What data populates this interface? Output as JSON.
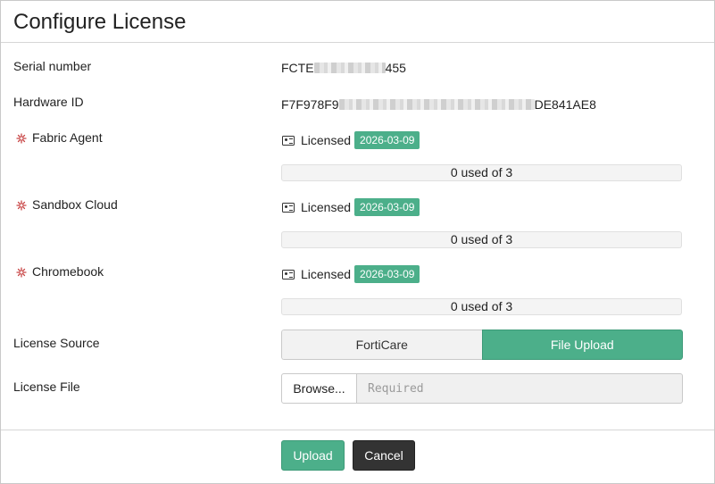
{
  "dialog": {
    "title": "Configure License"
  },
  "serial": {
    "label": "Serial number",
    "prefix": "FCTE",
    "suffix": "455"
  },
  "hardware": {
    "label": "Hardware ID",
    "prefix": "F7F978F9",
    "suffix": "DE841AE8"
  },
  "licenses": [
    {
      "label": "Fabric Agent",
      "status": "Licensed",
      "expiry": "2026-03-09",
      "usage": "0 used of 3",
      "used_fraction": 0
    },
    {
      "label": "Sandbox Cloud",
      "status": "Licensed",
      "expiry": "2026-03-09",
      "usage": "0 used of 3",
      "used_fraction": 0
    },
    {
      "label": "Chromebook",
      "status": "Licensed",
      "expiry": "2026-03-09",
      "usage": "0 used of 3",
      "used_fraction": 0
    }
  ],
  "license_source": {
    "label": "License Source",
    "options": [
      "FortiCare",
      "File Upload"
    ],
    "selected": "File Upload"
  },
  "license_file": {
    "label": "License File",
    "browse_label": "Browse...",
    "placeholder": "Required"
  },
  "footer": {
    "upload_label": "Upload",
    "cancel_label": "Cancel"
  },
  "colors": {
    "accent": "#4caf8a",
    "dark_button": "#333333",
    "gear": "#c94a4a"
  },
  "icons": {
    "license_type": "gear-icon",
    "licensed": "id-card-icon"
  }
}
